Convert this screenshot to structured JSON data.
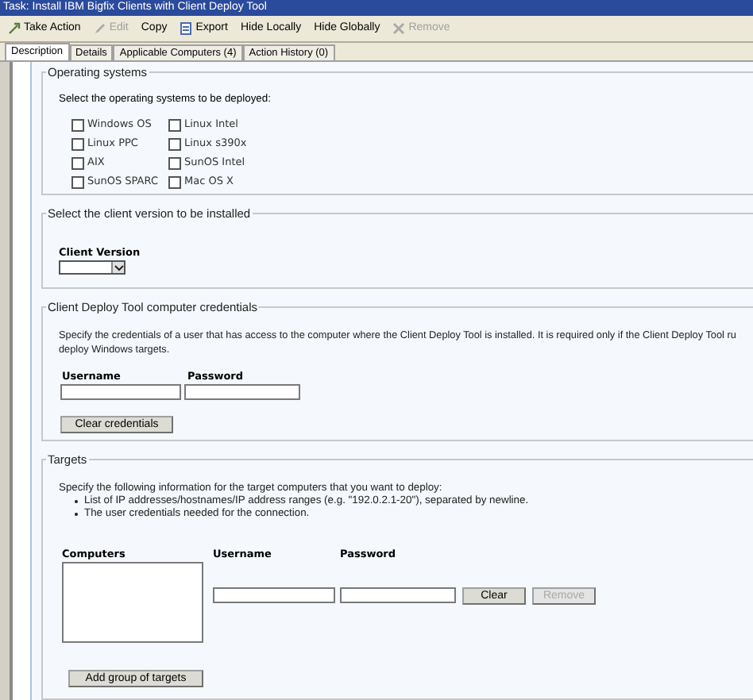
{
  "window": {
    "title": "Task: Install IBM Bigfix Clients with Client Deploy Tool"
  },
  "toolbar": [
    {
      "label": "Take Action",
      "disabled": false
    },
    {
      "label": "Edit",
      "disabled": true
    },
    {
      "label": "Copy",
      "disabled": false
    },
    {
      "label": "Export",
      "disabled": false
    },
    {
      "label": "Hide Locally",
      "disabled": false
    },
    {
      "label": "Hide Globally",
      "disabled": false
    },
    {
      "label": "Remove",
      "disabled": true
    }
  ],
  "tabs": [
    {
      "label": "Description",
      "selected": true
    },
    {
      "label": "Details",
      "selected": false
    },
    {
      "label": "Applicable Computers (4)",
      "selected": false
    },
    {
      "label": "Action History (0)",
      "selected": false
    }
  ],
  "operating_systems": {
    "legend": "Operating systems",
    "instruction": "Select the operating systems to be deployed:",
    "options": [
      {
        "label": "Windows OS",
        "checked": false
      },
      {
        "label": "Linux Intel",
        "checked": false
      },
      {
        "label": "Linux PPC",
        "checked": false
      },
      {
        "label": "Linux s390x",
        "checked": false
      },
      {
        "label": "AIX",
        "checked": false
      },
      {
        "label": "SunOS Intel",
        "checked": false
      },
      {
        "label": "SunOS SPARC",
        "checked": false
      },
      {
        "label": "Mac OS X",
        "checked": false
      }
    ]
  },
  "client_version": {
    "legend": "Select the client version to be installed",
    "label": "Client Version"
  },
  "credentials": {
    "legend": "Client Deploy Tool computer credentials",
    "description_lines": [
      "Specify the credentials of a user that has access to the computer where the Client Deploy Tool is installed. It is required only if the Client Deploy Tool ru",
      "deploy Windows targets."
    ],
    "username_label": "Username",
    "password_label": "Password",
    "clear_button": "Clear credentials"
  },
  "targets": {
    "legend": "Targets",
    "instruction": "Specify the following information for the target computers that you want to deploy:",
    "bullets": [
      "List of IP addresses/hostnames/IP address ranges (e.g. \"192.0.2.1-20\"), separated by newline.",
      "The user credentials needed for the connection."
    ],
    "computers_label": "Computers",
    "username_label": "Username",
    "password_label": "Password",
    "buttons": [
      {
        "label": "Clear",
        "disabled": false
      },
      {
        "label": "Remove",
        "disabled": true
      }
    ],
    "add_button": "Add group of targets"
  }
}
